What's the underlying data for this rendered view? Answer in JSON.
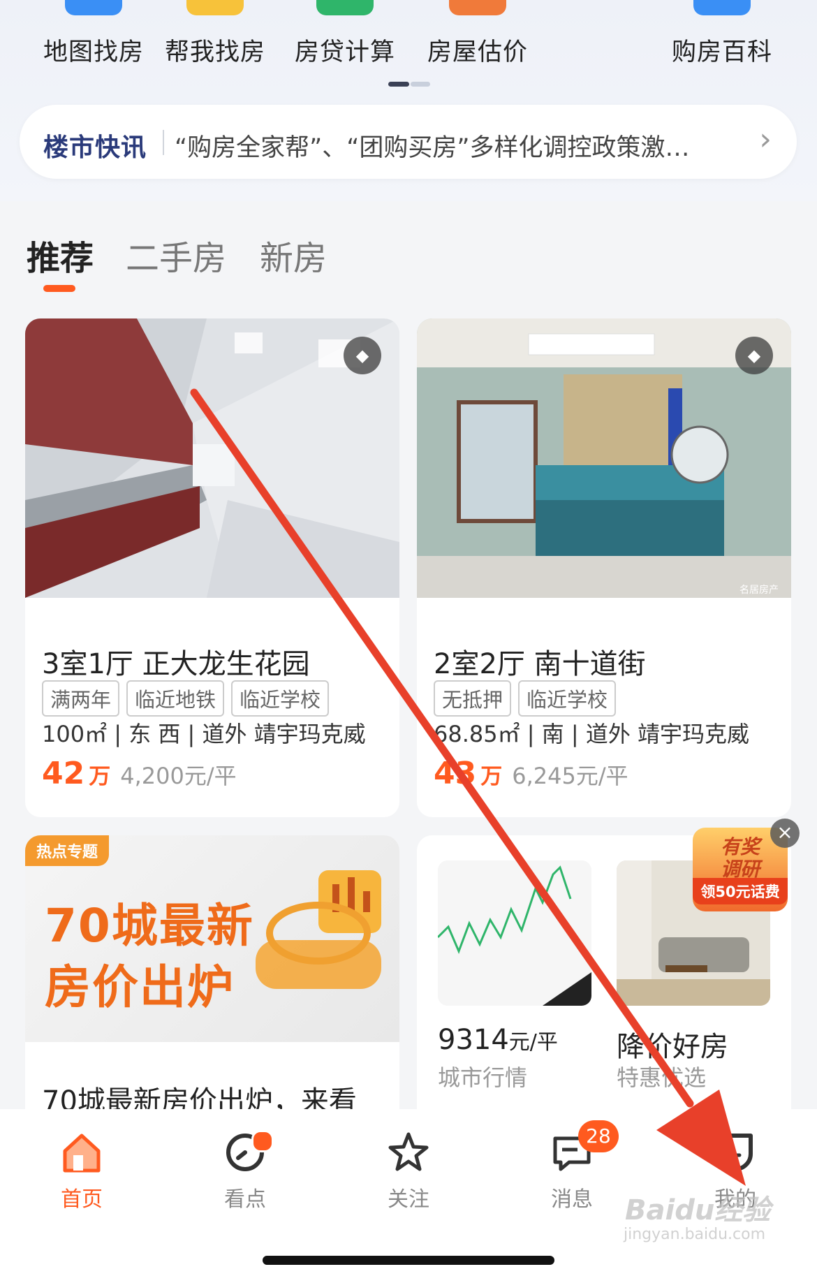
{
  "shortcuts": [
    {
      "label": "地图找房",
      "icon": "map-icon",
      "color": "#3a8ff5"
    },
    {
      "label": "帮我找房",
      "icon": "search-house-icon",
      "color": "#f7c23a"
    },
    {
      "label": "房贷计算",
      "icon": "calculator-icon",
      "color": "#2fb56a"
    },
    {
      "label": "房屋估价",
      "icon": "valuation-icon",
      "color": "#f07a3a"
    },
    {
      "label": "购房百科",
      "icon": "book-icon",
      "color": "#3a8ff5"
    }
  ],
  "news": {
    "tag": "楼市快讯",
    "text": "“购房全家帮”、“团购买房”多样化调控政策激…",
    "arrow": "›"
  },
  "feed_tabs": [
    {
      "label": "推荐",
      "active": true
    },
    {
      "label": "二手房",
      "active": false
    },
    {
      "label": "新房",
      "active": false
    }
  ],
  "listings": [
    {
      "title": "3室1厅 正大龙生花园",
      "tags": [
        "满两年",
        "临近地铁",
        "临近学校"
      ],
      "info": "100㎡ | 东 西 | 道外 靖宇玛克威",
      "price": "42",
      "unit": "万",
      "per": "4,200元/平"
    },
    {
      "title": "2室2厅 南十道街",
      "tags": [
        "无抵押",
        "临近学校"
      ],
      "info": "68.85㎡ | 南 | 道外 靖宇玛克威",
      "price": "43",
      "unit": "万",
      "per": "6,245元/平",
      "photo_watermark": "名居房产"
    }
  ],
  "topic": {
    "tag": "热点专题",
    "headline_1": "70城最新",
    "headline_2": "房价出炉",
    "title": "70城最新房价出炉，来看"
  },
  "market": {
    "value": "9314",
    "unit": "元/平",
    "sub": "城市行情"
  },
  "deal": {
    "title": "降价好房",
    "sub": "特惠优选"
  },
  "promo": {
    "line1": "有奖",
    "line2": "调研",
    "cta": "领50元话费"
  },
  "close_glyph": "×",
  "vr_glyph": "◆",
  "nav": [
    {
      "label": "首页",
      "icon": "home-icon",
      "active": true
    },
    {
      "label": "看点",
      "icon": "discover-icon",
      "active": false,
      "dot": true
    },
    {
      "label": "关注",
      "icon": "star-icon",
      "active": false
    },
    {
      "label": "消息",
      "icon": "message-icon",
      "active": false,
      "badge": "28"
    },
    {
      "label": "我的",
      "icon": "profile-icon",
      "active": false
    }
  ],
  "watermark": {
    "main": "Baidu经验",
    "sub": "jingyan.baidu.com"
  },
  "colors": {
    "accent": "#ff5a1f",
    "arrow": "#e8402a",
    "news_tag": "#2a3a7a"
  }
}
